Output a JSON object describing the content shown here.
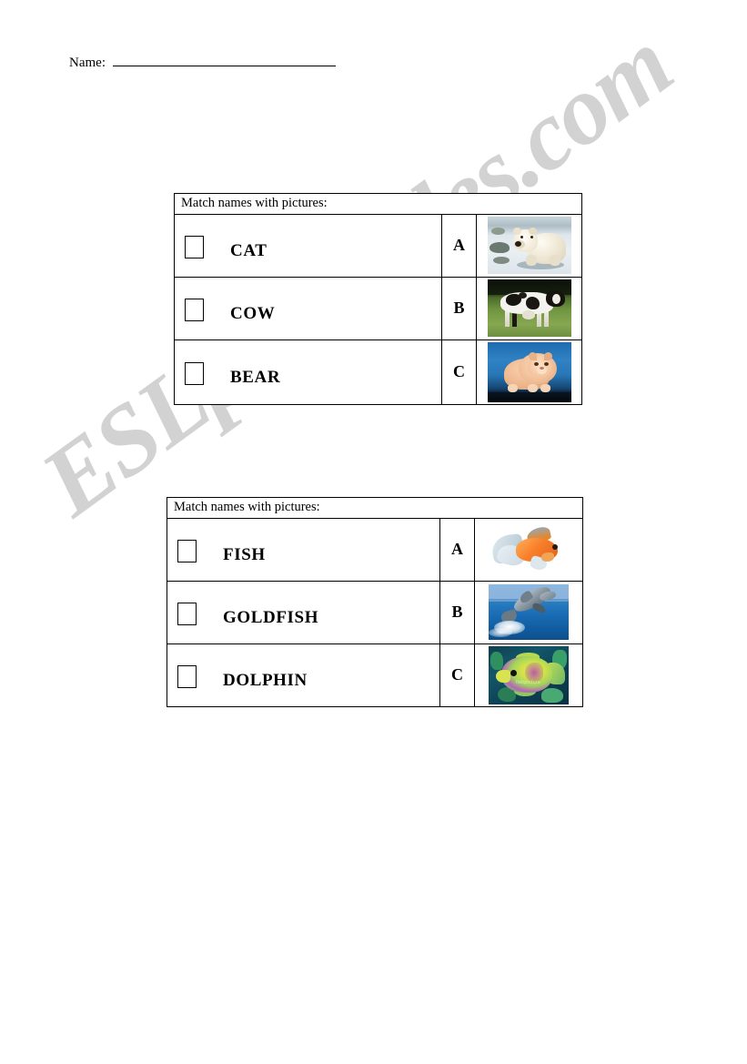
{
  "worksheet": {
    "name_label": "Name:",
    "name_value": ""
  },
  "tables": [
    {
      "header": "Match names with pictures:",
      "rows": [
        {
          "word": "CAT",
          "letter": "A",
          "picture": "polar-bear-cub-photo"
        },
        {
          "word": "COW",
          "letter": "B",
          "picture": "holstein-cow-photo"
        },
        {
          "word": "BEAR",
          "letter": "C",
          "picture": "persian-cat-photo"
        }
      ]
    },
    {
      "header": "Match names with pictures:",
      "rows": [
        {
          "word": "FISH",
          "letter": "A",
          "picture": "goldfish-photo"
        },
        {
          "word": "GOLDFISH",
          "letter": "B",
          "picture": "dolphin-photo"
        },
        {
          "word": "DOLPHIN",
          "letter": "C",
          "picture": "tropical-fish-photo"
        }
      ]
    }
  ],
  "watermark": {
    "text": "ESLprintables.com",
    "color": "#d2d2d2"
  },
  "picture_caption": {
    "tropical_fish_tag": "fishpicture"
  }
}
